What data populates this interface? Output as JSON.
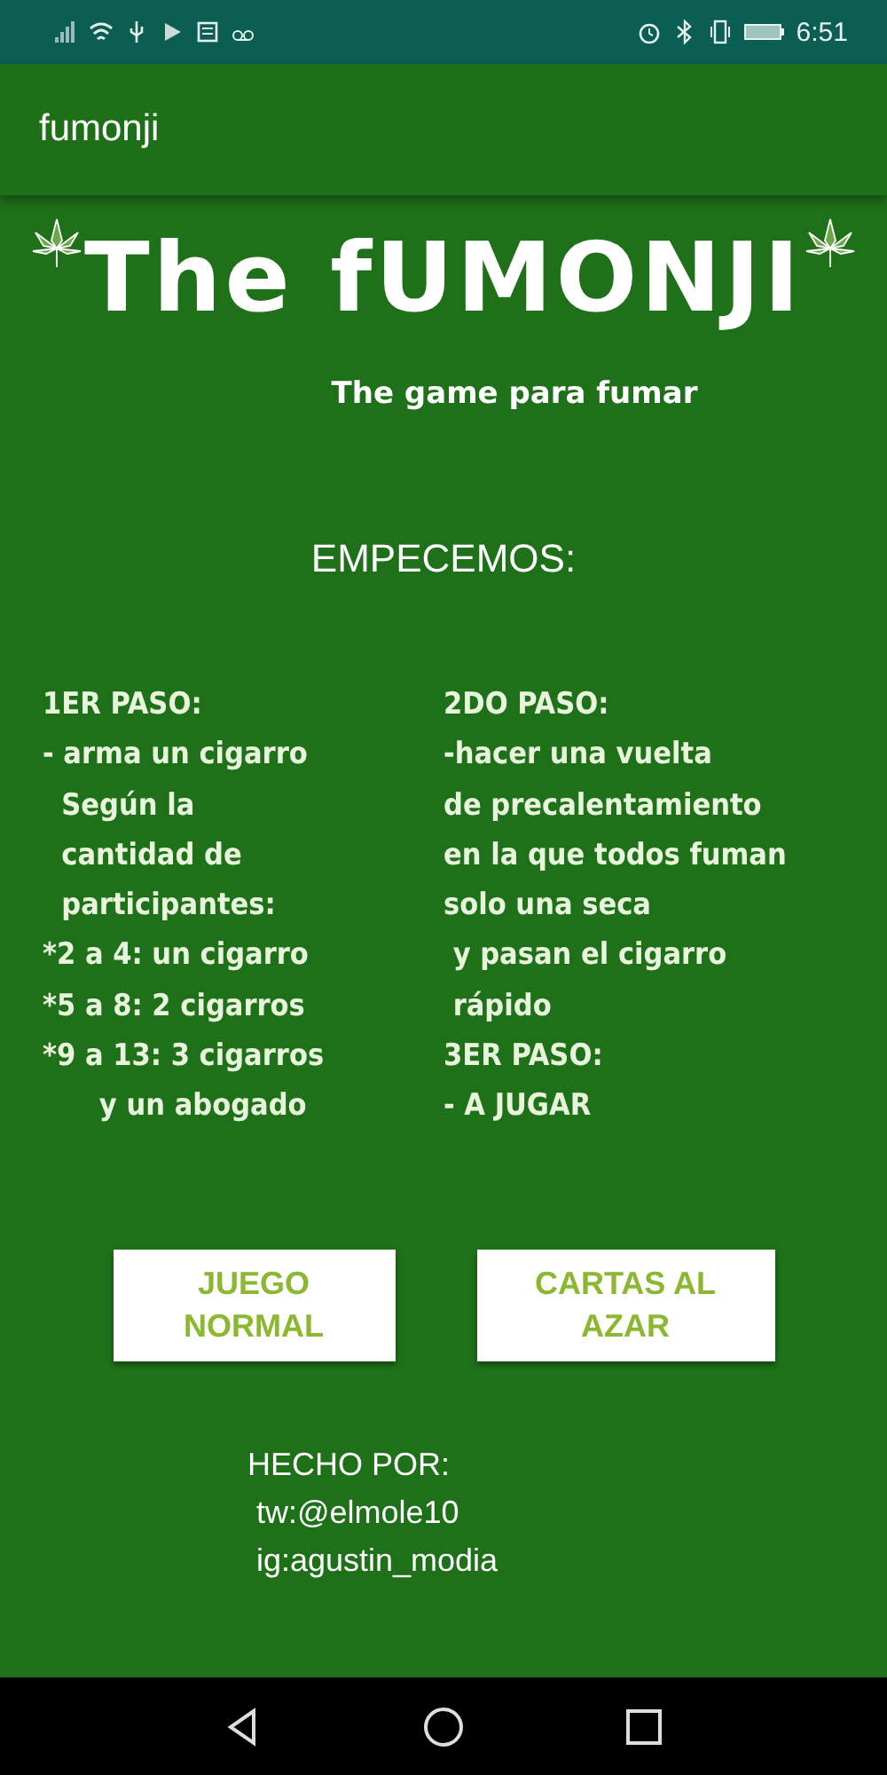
{
  "status_bar": {
    "time": "6:51"
  },
  "app_bar": {
    "title": "fumonji"
  },
  "logo": {
    "title": "The fUMONJI",
    "subtitle": "The game para fumar"
  },
  "heading": "EMPECEMOS:",
  "columns": [
    {
      "lines": [
        "1ER PASO:",
        "- arma un cigarro",
        "  Según la",
        "  cantidad de",
        "  participantes:",
        "*2 a 4: un cigarro",
        "*5 a 8: 2 cigarros",
        "*9 a 13: 3 cigarros",
        "      y un abogado"
      ]
    },
    {
      "lines": [
        "2DO PASO:",
        "-hacer una vuelta",
        "de precalentamiento",
        "en la que todos fuman",
        "solo una seca",
        " y pasan el cigarro",
        " rápido",
        "3ER PASO:",
        "- A JUGAR"
      ]
    }
  ],
  "buttons": [
    "JUEGO NORMAL",
    "CARTAS AL AZAR"
  ],
  "credits": [
    "HECHO POR:",
    " tw:@elmole10",
    " ig:agustin_modia"
  ]
}
